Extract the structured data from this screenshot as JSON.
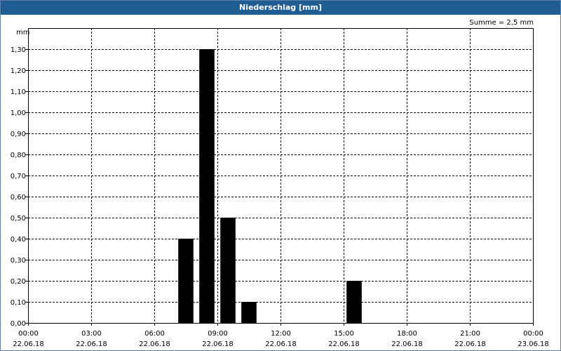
{
  "window": {
    "title": "Niederschlag [mm]"
  },
  "summary": {
    "text": "Summe = 2,5 mm"
  },
  "chart_data": {
    "type": "bar",
    "title": "Niederschlag [mm]",
    "ylabel": "mm",
    "xlabel": "",
    "ylim": [
      0,
      1.4
    ],
    "y_ticks": [
      "0,00",
      "0,10",
      "0,20",
      "0,30",
      "0,40",
      "0,50",
      "0,60",
      "0,70",
      "0,80",
      "0,90",
      "1,00",
      "1,10",
      "1,20",
      "1,30"
    ],
    "x_range_hours": [
      0,
      24
    ],
    "x_ticks": [
      {
        "time": "00:00",
        "date": "22.06.18"
      },
      {
        "time": "03:00",
        "date": "22.06.18"
      },
      {
        "time": "06:00",
        "date": "22.06.18"
      },
      {
        "time": "09:00",
        "date": "22.06.18"
      },
      {
        "time": "12:00",
        "date": "22.06.18"
      },
      {
        "time": "15:00",
        "date": "22.06.18"
      },
      {
        "time": "18:00",
        "date": "22.06.18"
      },
      {
        "time": "21:00",
        "date": "22.06.18"
      },
      {
        "time": "00:00",
        "date": "23.06.18"
      }
    ],
    "categories": [
      "08:00",
      "09:00",
      "10:00",
      "11:00",
      "16:00"
    ],
    "values": [
      0.4,
      1.3,
      0.5,
      0.1,
      0.2
    ],
    "grid": true,
    "bar_color": "#000000",
    "total": "2,5 mm"
  }
}
